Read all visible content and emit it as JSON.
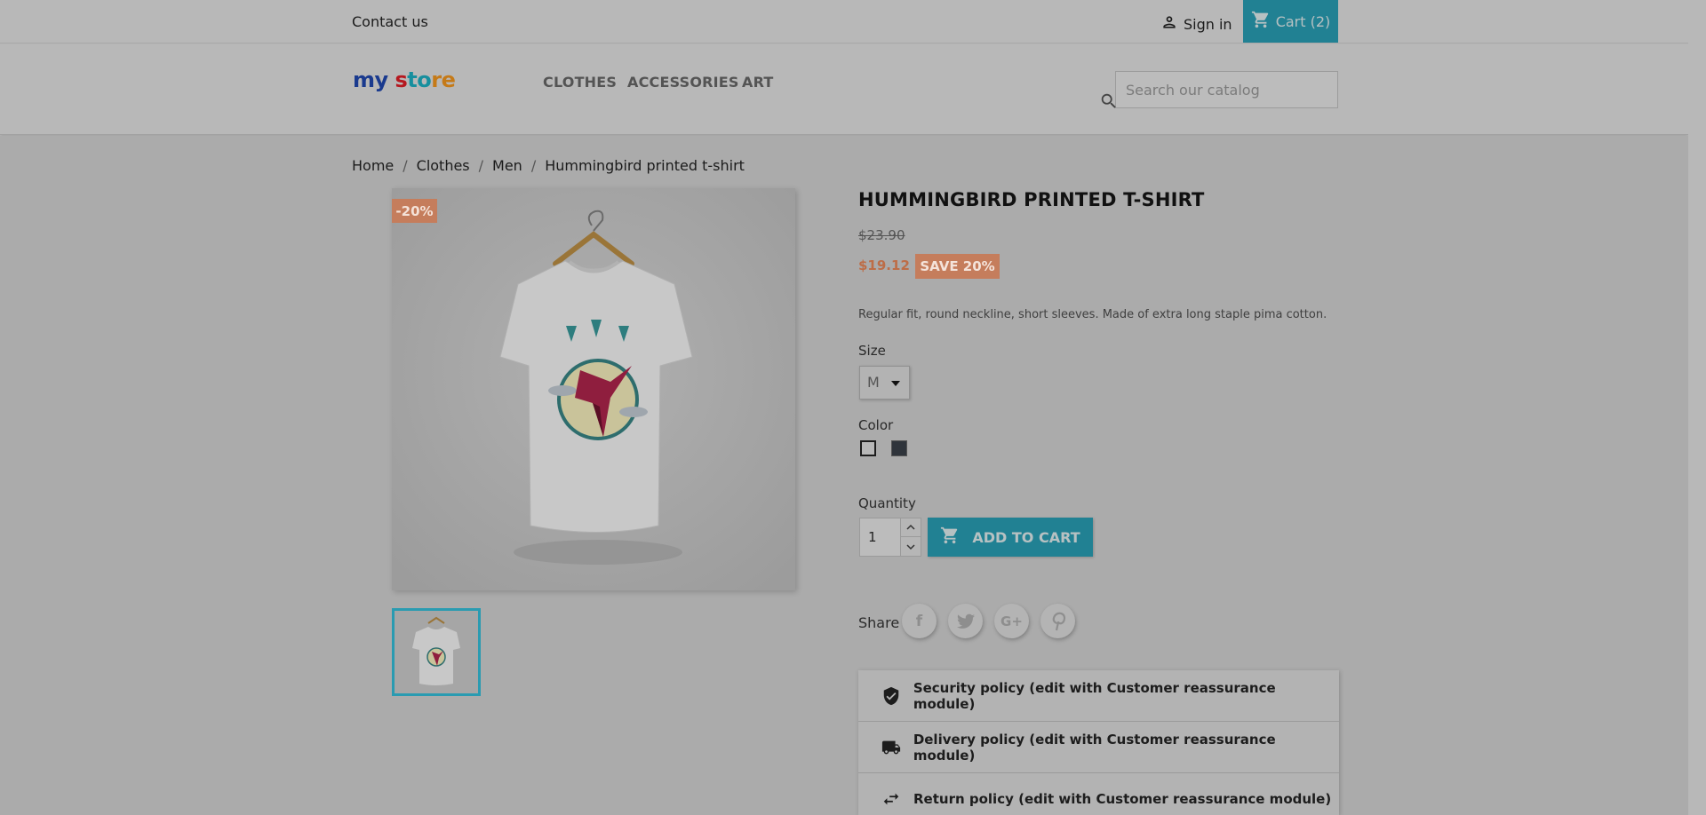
{
  "header": {
    "contact": "Contact us",
    "signin": "Sign in",
    "cart": "Cart (2)",
    "search_placeholder": "Search our catalog"
  },
  "logo": {
    "part1": "my",
    "part2": " s",
    "part3": "to",
    "part4": "re"
  },
  "menu": [
    "CLOTHES",
    "ACCESSORIES",
    "ART"
  ],
  "breadcrumb": [
    "Home",
    "Clothes",
    "Men",
    "Hummingbird printed t-shirt"
  ],
  "product": {
    "discount_flag": "-20%",
    "title": "HUMMINGBIRD PRINTED T-SHIRT",
    "old_price": "$23.90",
    "price": "$19.12",
    "save_badge": "SAVE 20%",
    "description": "Regular fit, round neckline, short sleeves. Made of extra long staple pima cotton.",
    "size_label": "Size",
    "size_value": "M",
    "color_label": "Color",
    "colors": [
      "#ffffff",
      "#2f343b"
    ],
    "quantity_label": "Quantity",
    "quantity_value": "1",
    "add_to_cart": "ADD TO CART",
    "share_label": "Share",
    "share_icons": [
      "facebook-icon",
      "twitter-icon",
      "google-plus-icon",
      "pinterest-icon"
    ]
  },
  "reassurance": [
    {
      "icon": "shield-check-icon",
      "text": "Security policy (edit with Customer reassurance module)"
    },
    {
      "icon": "truck-icon",
      "text": "Delivery policy (edit with Customer reassurance module)"
    },
    {
      "icon": "swap-arrows-icon",
      "text": "Return policy (edit with Customer reassurance module)"
    }
  ],
  "colors": {
    "accent": "#2aa6bd",
    "discount": "#c57d5c",
    "overlay": "#b8b8b8"
  }
}
